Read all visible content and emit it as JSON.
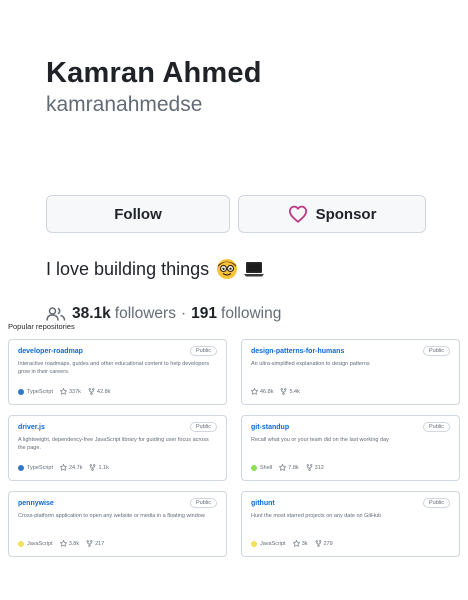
{
  "profile": {
    "name": "Kamran Ahmed",
    "login": "kamranahmedse",
    "follow_label": "Follow",
    "sponsor_label": "Sponsor",
    "bio": "I love building things",
    "followers_count": "38.1k",
    "followers_label": "followers",
    "separator": "·",
    "following_count": "191",
    "following_label": "following"
  },
  "popular": {
    "title": "Popular repositories",
    "repos": [
      {
        "name": "developer-roadmap",
        "visibility": "Public",
        "description": "Interactive roadmaps, guides and other educational content to help developers grow in their careers.",
        "language": "TypeScript",
        "language_color": "#3178c6",
        "stars": "337k",
        "forks": "42.8k"
      },
      {
        "name": "design-patterns-for-humans",
        "visibility": "Public",
        "description": "An ultra-simplified explanation to design patterns",
        "language": "",
        "language_color": "",
        "stars": "46.8k",
        "forks": "5.4k"
      },
      {
        "name": "driver.js",
        "visibility": "Public",
        "description": "A lightweight, dependency-free JavaScript library for guiding user focus across the page.",
        "language": "TypeScript",
        "language_color": "#3178c6",
        "stars": "24.7k",
        "forks": "1.1k"
      },
      {
        "name": "git-standup",
        "visibility": "Public",
        "description": "Recall what you or your team did on the last working day",
        "language": "Shell",
        "language_color": "#89e051",
        "stars": "7.8k",
        "forks": "312"
      },
      {
        "name": "pennywise",
        "visibility": "Public",
        "description": "Cross-platform application to open any website or media in a floating window",
        "language": "JavaScript",
        "language_color": "#f1e05a",
        "stars": "3.8k",
        "forks": "217"
      },
      {
        "name": "githunt",
        "visibility": "Public",
        "description": "Hunt the most starred projects on any date on GitHub",
        "language": "JavaScript",
        "language_color": "#f1e05a",
        "stars": "3k",
        "forks": "279"
      }
    ]
  },
  "icons": {
    "heart": "heart-icon",
    "people": "people-icon",
    "star": "star-icon",
    "fork": "fork-icon",
    "emoji_face": "nerd-face-emoji",
    "emoji_laptop": "laptop-emoji"
  },
  "colors": {
    "link": "#0969da",
    "heart": "#bf3989",
    "border": "#d0d7de",
    "muted": "#636c76"
  }
}
